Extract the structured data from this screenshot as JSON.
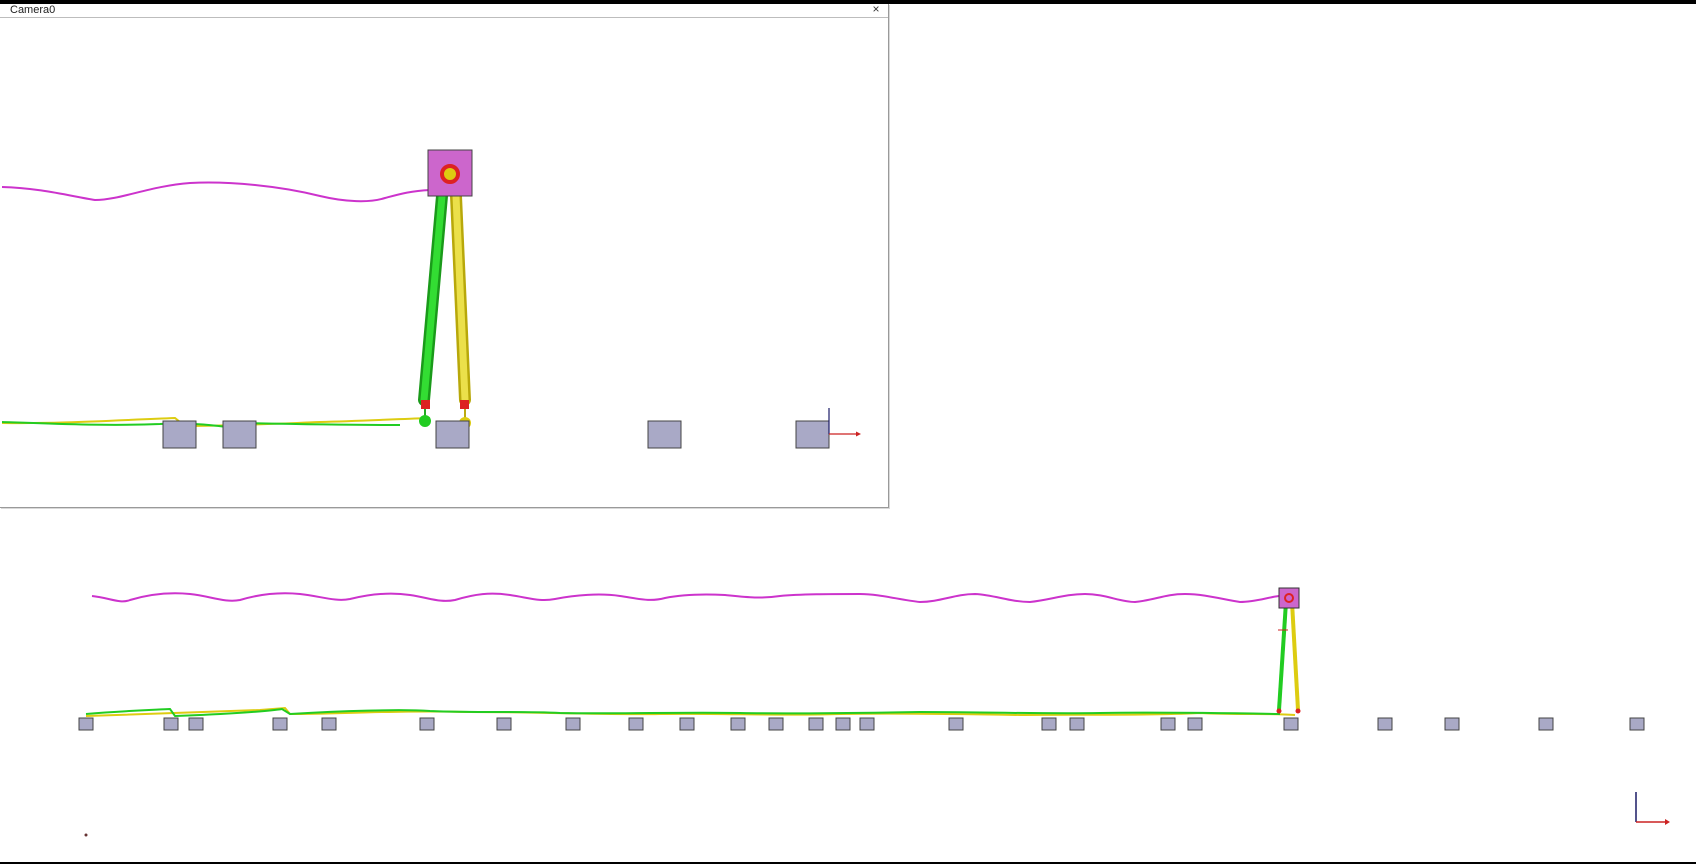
{
  "camera_window": {
    "title": "Camera0",
    "close_glyph": "×"
  },
  "colors": {
    "background": "#ffffff",
    "body_fill": "#cc66cc",
    "trajectory_body": "#cc33cc",
    "leg_green": "#22cc22",
    "leg_yellow": "#ddcc11",
    "foot_red": "#dd2222",
    "obstacle_fill": "#a9a9c6",
    "axis_red": "#cc2222"
  }
}
